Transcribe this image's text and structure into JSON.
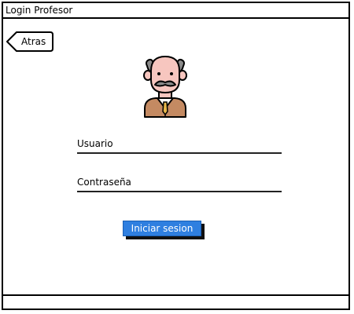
{
  "window": {
    "title": "Login Profesor"
  },
  "back_button": {
    "label": "Atras"
  },
  "avatar": {
    "icon": "teacher-avatar-icon"
  },
  "form": {
    "username_label": "Usuario",
    "username_value": "",
    "password_label": "Contraseña",
    "password_value": ""
  },
  "login_button": {
    "label": "Iniciar sesion"
  },
  "colors": {
    "accent": "#2f7fe0",
    "accent_border": "#1a5fb4",
    "text": "#000000",
    "background": "#ffffff"
  }
}
